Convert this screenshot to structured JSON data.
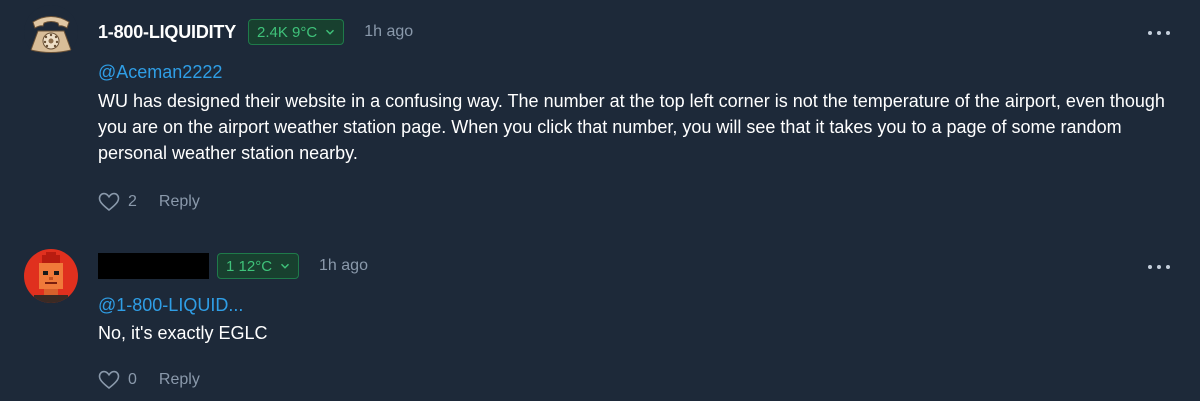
{
  "comments": [
    {
      "username": "1-800-LIQUIDITY",
      "badge": "2.4K 9°C",
      "time": "1h ago",
      "mention": "@Aceman2222",
      "body": "WU has designed their website in a confusing way. The number at the top left corner is not the temperature of the airport, even though you are on the airport weather station page. When you click that number, you will see that it takes you to a page of some random personal weather station nearby.",
      "likes": "2",
      "reply_label": "Reply",
      "avatar_icon": "rotary-phone-icon"
    },
    {
      "username": "",
      "badge": "1 12°C",
      "time": "1h ago",
      "mention": "@1-800-LIQUID...",
      "body": "No, it's exactly EGLC",
      "likes": "0",
      "reply_label": "Reply",
      "avatar_icon": "red-pixel-face-icon"
    }
  ],
  "colors": {
    "background": "#1d2939",
    "mention": "#2f9ee6",
    "badge_text": "#3fc27a",
    "muted": "#8a99ab"
  }
}
